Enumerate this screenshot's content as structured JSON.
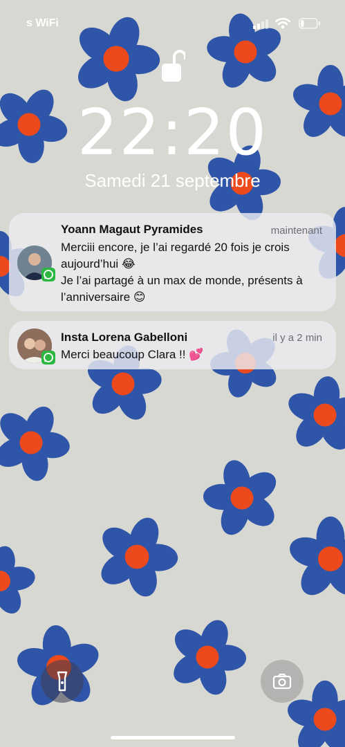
{
  "status_bar": {
    "carrier": "s WiFi",
    "battery_level": 0.2
  },
  "lock_screen": {
    "time": "22:20",
    "date": "Samedi 21 septembre"
  },
  "notifications": [
    {
      "title": "Yoann Magaut Pyramides",
      "time": "maintenant",
      "body": "Merciii encore, je l’ai regardé 20 fois je crois aujourd’hui 😂\nJe l’ai partagé à un max de monde, présents à l’anniversaire 😊",
      "app_icon": "whatsapp-icon"
    },
    {
      "title": "Insta Lorena Gabelloni",
      "time": "il y a 2 min",
      "body": "Merci beaucoup Clara !! 💕",
      "app_icon": "whatsapp-icon"
    }
  ],
  "quick_actions": {
    "left": "flashlight-icon",
    "right": "camera-icon"
  },
  "colors": {
    "wallpaper_bg": "#d8d8d3",
    "flower_petal": "#2f55a8",
    "flower_center": "#ec4a1c",
    "whatsapp": "#2bb741"
  }
}
